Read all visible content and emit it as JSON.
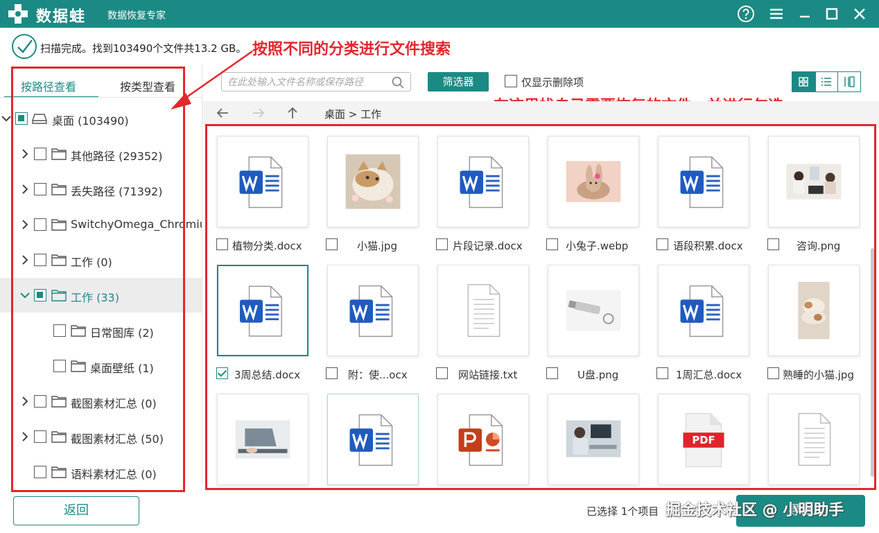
{
  "app": {
    "name": "数据蛙",
    "subtitle": "数据恢复专家"
  },
  "status": {
    "text": "扫描完成。找到103490个文件共13.2 GB。"
  },
  "annotations": {
    "top": "按照不同的分类进行文件搜索",
    "grid": "在这里找自己需要恢复的文件，并进行勾选"
  },
  "tabs": [
    {
      "label": "按路径查看"
    },
    {
      "label": "按类型查看"
    }
  ],
  "tree": [
    {
      "label": "桌面 (103490)"
    },
    {
      "label": "其他路径 (29352)"
    },
    {
      "label": "丢失路径 (71392)"
    },
    {
      "label": "SwitchyOmega_Chromium"
    },
    {
      "label": "工作 (0)"
    },
    {
      "label": "工作 (33)"
    },
    {
      "label": "日常图库 (2)"
    },
    {
      "label": "桌面壁纸 (1)"
    },
    {
      "label": "截图素材汇总 (0)"
    },
    {
      "label": "截图素材汇总 (50)"
    },
    {
      "label": "语料素材汇总 (0)"
    }
  ],
  "toolbar": {
    "search_placeholder": "在此处输入文件名称或保存路径",
    "filter_label": "筛选器",
    "deleted_only_label": "仅显示删除项"
  },
  "breadcrumb": {
    "path": "桌面 > 工作"
  },
  "files": [
    {
      "name": "植物分类.docx",
      "type": "word",
      "checked": false
    },
    {
      "name": "小猫.jpg",
      "type": "photo-cat",
      "checked": false
    },
    {
      "name": "片段记录.docx",
      "type": "word",
      "checked": false
    },
    {
      "name": "小兔子.webp",
      "type": "photo-rabbit",
      "checked": false
    },
    {
      "name": "语段积累.docx",
      "type": "word",
      "checked": false
    },
    {
      "name": "咨询.png",
      "type": "photo-consult",
      "checked": false
    },
    {
      "name": "3周总结.docx",
      "type": "word",
      "checked": true
    },
    {
      "name": "附：使...ocx",
      "type": "word",
      "checked": false
    },
    {
      "name": "网站链接.txt",
      "type": "text",
      "checked": false
    },
    {
      "name": "U盘.png",
      "type": "photo-usb",
      "checked": false
    },
    {
      "name": "1周汇总.docx",
      "type": "word",
      "checked": false
    },
    {
      "name": "熟睡的小猫.jpg",
      "type": "photo-kittens",
      "checked": false
    },
    {
      "name": "",
      "type": "photo-laptop",
      "checked": false
    },
    {
      "name": "",
      "type": "word",
      "checked": false
    },
    {
      "name": "",
      "type": "powerpoint",
      "checked": false
    },
    {
      "name": "",
      "type": "photo-office",
      "checked": false
    },
    {
      "name": "",
      "type": "pdf",
      "checked": false
    },
    {
      "name": "",
      "type": "text",
      "checked": false
    }
  ],
  "footer": {
    "back_label": "返回",
    "selection_info": "已选择 1个项目",
    "export_label": "导出",
    "watermark": "掘金技术社区 @ 小明助手"
  },
  "colors": {
    "primary": "#1c8a84",
    "annotation": "#e3262d"
  }
}
